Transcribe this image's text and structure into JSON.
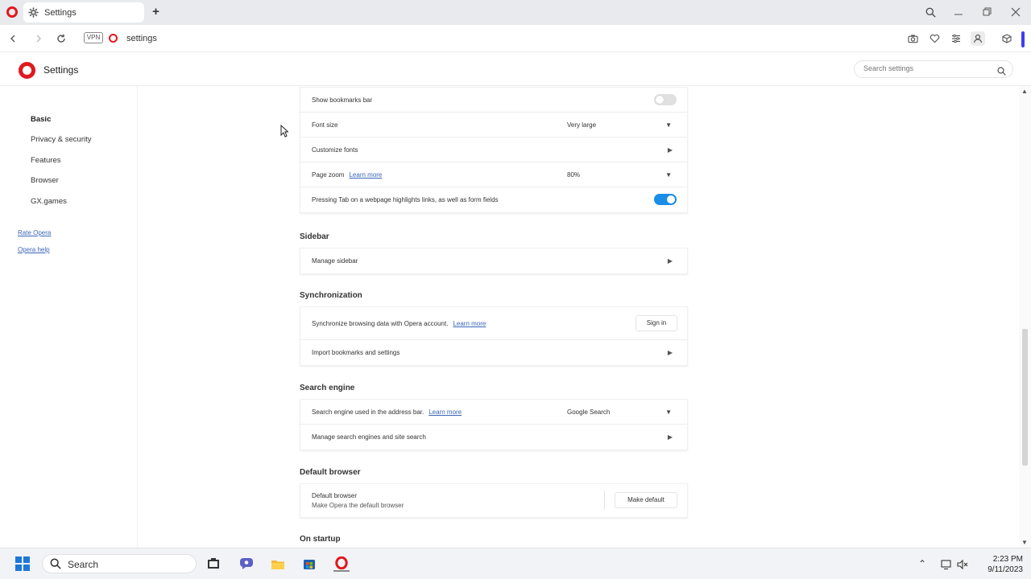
{
  "tab": {
    "title": "Settings"
  },
  "address": {
    "vpn_label": "VPN",
    "url": "settings"
  },
  "header": {
    "title": "Settings",
    "search_placeholder": "Search settings"
  },
  "sidebar": {
    "items": [
      {
        "label": "Basic"
      },
      {
        "label": "Privacy & security"
      },
      {
        "label": "Features"
      },
      {
        "label": "Browser"
      },
      {
        "label": "GX.games"
      }
    ],
    "links": [
      {
        "label": "Rate Opera"
      },
      {
        "label": "Opera help"
      }
    ]
  },
  "appearance": {
    "show_bookmarks_bar": {
      "label": "Show bookmarks bar",
      "enabled": false
    },
    "font_size": {
      "label": "Font size",
      "value": "Very large"
    },
    "customize_fonts": {
      "label": "Customize fonts"
    },
    "page_zoom": {
      "label": "Page zoom",
      "learn_more": "Learn more",
      "value": "80%"
    },
    "tab_highlight": {
      "label": "Pressing Tab on a webpage highlights links, as well as form fields",
      "enabled": true
    }
  },
  "sidebar_section": {
    "title": "Sidebar",
    "manage_label": "Manage sidebar"
  },
  "sync_section": {
    "title": "Synchronization",
    "sync_label": "Synchronize browsing data with Opera account.",
    "learn_more": "Learn more",
    "sign_in": "Sign in",
    "import_label": "Import bookmarks and settings"
  },
  "search_section": {
    "title": "Search engine",
    "engine_label": "Search engine used in the address bar.",
    "learn_more": "Learn more",
    "engine_value": "Google Search",
    "manage_label": "Manage search engines and site search"
  },
  "default_browser_section": {
    "title": "Default browser",
    "row_title": "Default browser",
    "row_sub": "Make Opera the default browser",
    "button": "Make default"
  },
  "startup_section": {
    "title": "On startup"
  },
  "taskbar": {
    "search_label": "Search",
    "time": "2:23 PM",
    "date": "9/11/2023"
  },
  "colors": {
    "opera_red": "#e0191f",
    "toggle_on": "#1a8de6",
    "link": "#3b66b8",
    "win_blue": "#1e78d7"
  }
}
